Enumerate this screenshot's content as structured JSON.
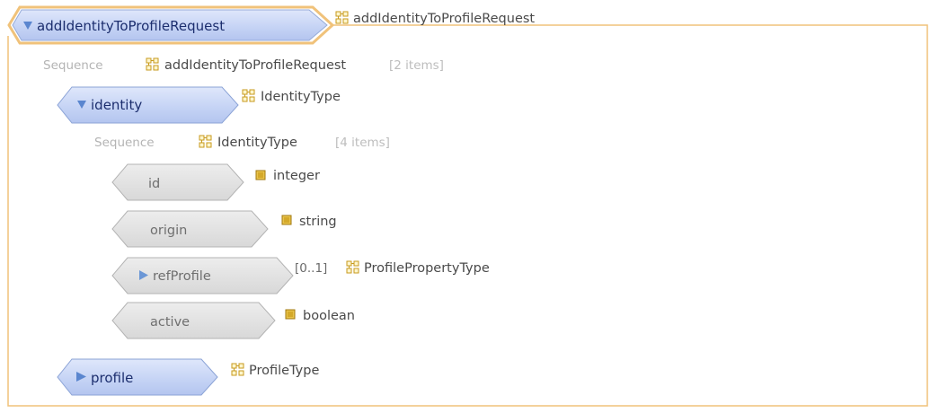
{
  "colors": {
    "frame_border": "#f0c27a",
    "blue_element_fill": "#c9d6f4",
    "grey_element_fill": "#e3e3e3",
    "triangle": "#5a86cf",
    "type_icon": "#c79a1e"
  },
  "root": {
    "name": "addIdentityToProfileRequest",
    "type": "addIdentityToProfileRequest",
    "type_icon": "complex-type-icon",
    "sequence": {
      "label": "Sequence",
      "type": "addIdentityToProfileRequest",
      "count": "[2 items]"
    }
  },
  "identity": {
    "name": "identity",
    "type": "IdentityType",
    "sequence": {
      "label": "Sequence",
      "type": "IdentityType",
      "count": "[4 items]"
    }
  },
  "fields": [
    {
      "name": "id",
      "bounds": "",
      "type": "integer",
      "type_icon": "simple-type-icon"
    },
    {
      "name": "origin",
      "bounds": "",
      "type": "string",
      "type_icon": "simple-type-icon"
    },
    {
      "name": "refProfile",
      "bounds": "[0..1]",
      "type": "ProfilePropertyType",
      "type_icon": "complex-type-icon"
    },
    {
      "name": "active",
      "bounds": "",
      "type": "boolean",
      "type_icon": "simple-type-icon"
    }
  ],
  "profile": {
    "name": "profile",
    "type": "ProfileType"
  }
}
